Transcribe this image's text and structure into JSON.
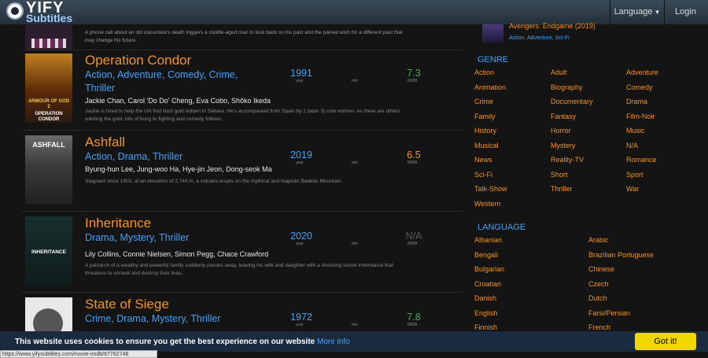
{
  "header": {
    "logo_main": "YIFY",
    "logo_sub": "Subtitles",
    "language_label": "Language",
    "login_label": "Login"
  },
  "movies": [
    {
      "title": "",
      "genres": "",
      "year": "",
      "year_label": "",
      "min_label": "",
      "rating": "",
      "rating_label": "",
      "cast": "",
      "description": "A phone call about an old classmate's death triggers a middle-aged man to look back on his past and the pained wish for a different past that may change his future."
    },
    {
      "title": "Operation Condor",
      "genres": "Action, Adventure, Comedy, Crime, Thriller",
      "year": "1991",
      "year_label": "year",
      "min_label": "min",
      "rating": "7.3",
      "rating_label": "IMDB",
      "cast": "Jackie Chan, Carol 'Do Do' Cheng, Eva Cobo, Shôko Ikeda",
      "description": "Jackie is hired to help the UN find Nazi gold hidden in Sahara. He's accompanied from Spain by 2 (later 3) cute women. As there are others wanting the gold, lots of kung fu fighting and comedy follows."
    },
    {
      "title": "Ashfall",
      "genres": "Action, Drama, Thriller",
      "year": "2019",
      "year_label": "year",
      "min_label": "min",
      "rating": "6.5",
      "rating_label": "IMDB",
      "cast": "Byung-hun Lee, Jung-woo Ha, Hye-jin Jeon, Dong-seok Ma",
      "description": "Stagnant since 1903, at an elevation of 2,744 m, a volcano erupts on the mythical and majestic Baekdu Mountain."
    },
    {
      "title": "Inheritance",
      "genres": "Drama, Mystery, Thriller",
      "year": "2020",
      "year_label": "year",
      "min_label": "min",
      "rating": "N/A",
      "rating_label": "IMDB",
      "cast": "Lily Collins, Connie Nielsen, Simon Pegg, Chace Crawford",
      "description": "A patriarch of a wealthy and powerful family suddenly passes away, leaving his wife and daughter with a shocking secret inheritance that threatens to unravel and destroy their lives."
    },
    {
      "title": "State of Siege",
      "genres": "Crime, Drama, Mystery, Thriller",
      "year": "1972",
      "year_label": "year",
      "min_label": "min",
      "rating": "7.8",
      "rating_label": "IMDB",
      "cast": "",
      "description": ""
    }
  ],
  "poster_texts": [
    "ARMOUR OF GOD 2",
    "OPERATION CONDOR",
    "ASHFALL",
    "INHERITANCE"
  ],
  "sidebar": {
    "featured": {
      "title": "Avengers: Endgame (2019)",
      "genres": "Action, Adventure, Sci-Fi"
    },
    "genre_heading": "GENRE",
    "genres": [
      "Action",
      "Adult",
      "Adventure",
      "Animation",
      "Biography",
      "Comedy",
      "Crime",
      "Documentary",
      "Drama",
      "Family",
      "Fantasy",
      "Film-Noir",
      "History",
      "Horror",
      "Music",
      "Musical",
      "Mystery",
      "N/A",
      "News",
      "Reality-TV",
      "Romance",
      "Sci-Fi",
      "Short",
      "Sport",
      "Talk-Show",
      "Thriller",
      "War",
      "Western"
    ],
    "language_heading": "LANGUAGE",
    "languages": [
      "Albanian",
      "Arabic",
      "Bengali",
      "Brazilian Portuguese",
      "Bulgarian",
      "Chinese",
      "Croatian",
      "Czech",
      "Danish",
      "Dutch",
      "English",
      "Farsi/Persian",
      "Finnish",
      "French"
    ]
  },
  "cookie": {
    "text": "This website uses cookies to ensure you get the best experience on our website",
    "link": "More info",
    "button": "Got it!"
  },
  "status_url": "https://www.yifysubtitles.com/movie-imdb/tt7762748",
  "colors": {
    "accent_orange": "#f7931e",
    "link_blue": "#3ea3ff",
    "rating_green": "#3fb54a",
    "cookie_button": "#f1d600",
    "cookie_bar": "#1a2b3f"
  }
}
